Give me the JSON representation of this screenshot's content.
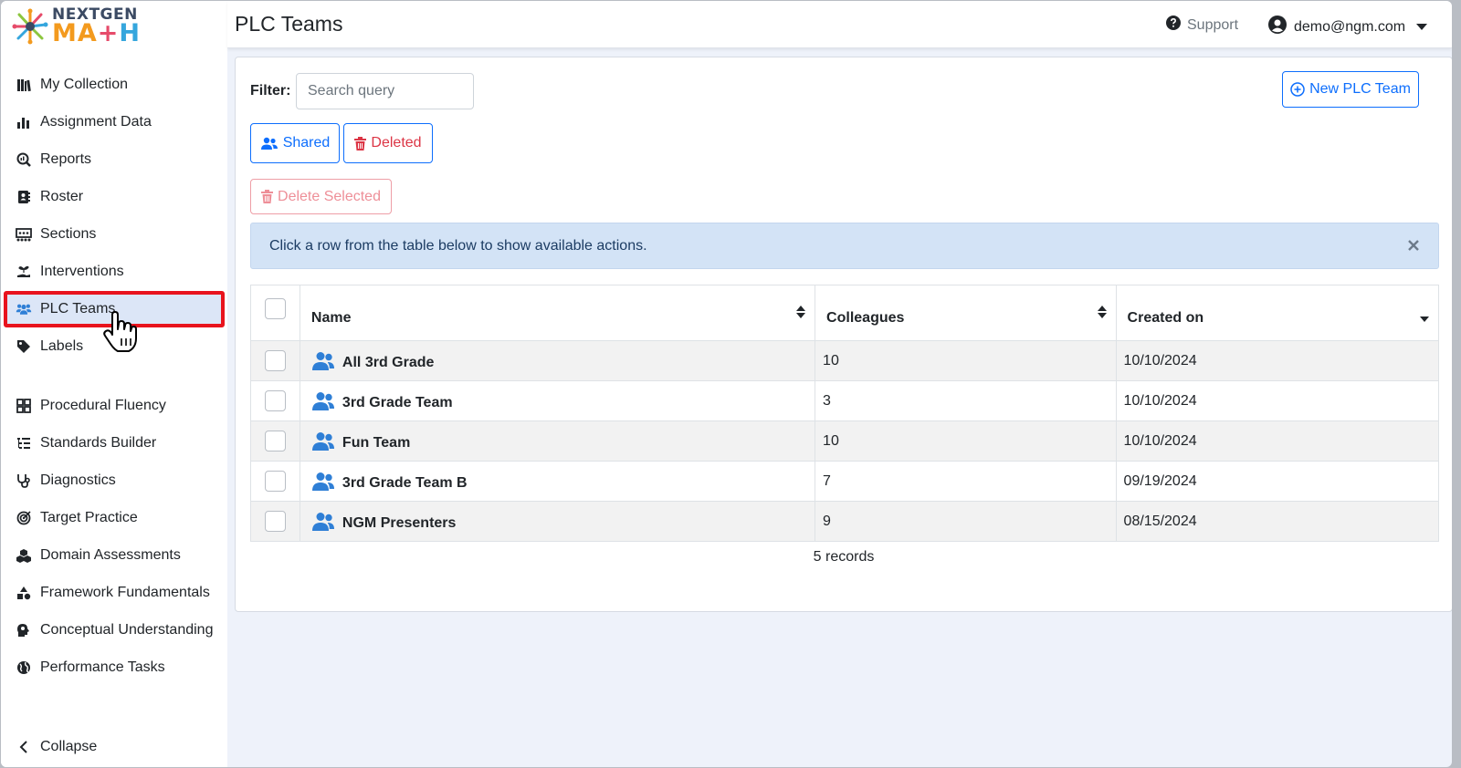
{
  "app": {
    "logo_top": "NEXTGEN",
    "logo_bottom_1": "MA",
    "logo_bottom_2": "+",
    "logo_bottom_3": "H"
  },
  "header": {
    "title": "PLC Teams",
    "support_label": "Support",
    "user_email": "demo@ngm.com"
  },
  "sidebar": {
    "items": [
      {
        "label": "My Collection",
        "icon": "books-icon"
      },
      {
        "label": "Assignment Data",
        "icon": "bar-chart-icon"
      },
      {
        "label": "Reports",
        "icon": "magnify-chart-icon"
      },
      {
        "label": "Roster",
        "icon": "address-book-icon"
      },
      {
        "label": "Sections",
        "icon": "grid-sections-icon"
      },
      {
        "label": "Interventions",
        "icon": "hand-seedling-icon"
      },
      {
        "label": "PLC Teams",
        "icon": "users-icon"
      },
      {
        "label": "Labels",
        "icon": "tag-icon"
      },
      {
        "label": "Procedural Fluency",
        "icon": "grid-squares-icon"
      },
      {
        "label": "Standards Builder",
        "icon": "list-tree-icon"
      },
      {
        "label": "Diagnostics",
        "icon": "stethoscope-icon"
      },
      {
        "label": "Target Practice",
        "icon": "target-icon"
      },
      {
        "label": "Domain Assessments",
        "icon": "cubes-icon"
      },
      {
        "label": "Framework Fundamentals",
        "icon": "shapes-icon"
      },
      {
        "label": "Conceptual Understanding",
        "icon": "brain-head-icon"
      },
      {
        "label": "Performance Tasks",
        "icon": "globe-icon"
      }
    ],
    "active_index": 6,
    "collapse_label": "Collapse"
  },
  "main": {
    "filter_label": "Filter:",
    "filter_placeholder": "Search query",
    "new_button": "New PLC Team",
    "shared_button": "Shared",
    "deleted_button": "Deleted",
    "delete_selected_button": "Delete Selected",
    "alert_text": "Click a row from the table below to show available actions.",
    "table": {
      "columns": [
        "Name",
        "Colleagues",
        "Created on"
      ],
      "rows": [
        {
          "name": "All 3rd Grade",
          "colleagues": "10",
          "created": "10/10/2024"
        },
        {
          "name": "3rd Grade Team",
          "colleagues": "3",
          "created": "10/10/2024"
        },
        {
          "name": "Fun Team",
          "colleagues": "10",
          "created": "10/10/2024"
        },
        {
          "name": "3rd Grade Team B",
          "colleagues": "7",
          "created": "09/19/2024"
        },
        {
          "name": "NGM Presenters",
          "colleagues": "9",
          "created": "08/15/2024"
        }
      ]
    },
    "records_text": "5 records"
  },
  "colors": {
    "primary": "#0d6efd",
    "danger": "#dc3545",
    "highlight_border": "#e8131d",
    "team_icon": "#2f7fd6"
  }
}
